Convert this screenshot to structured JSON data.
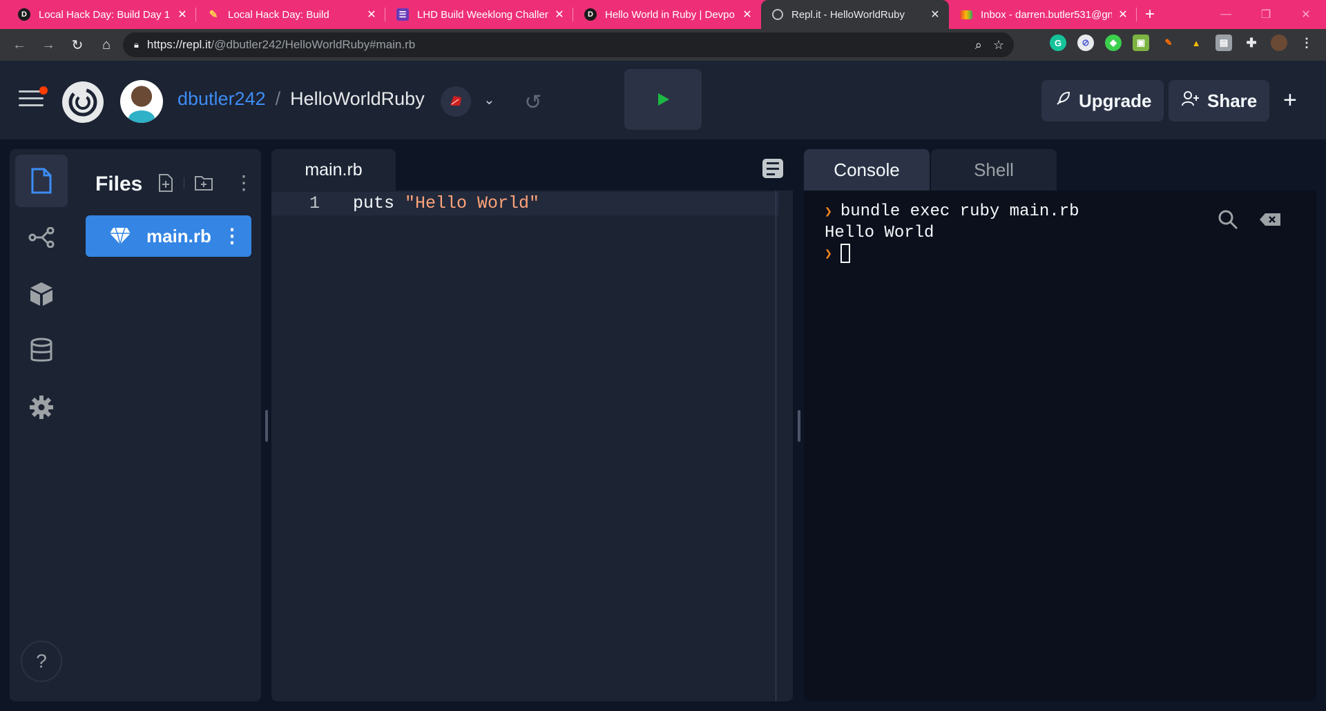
{
  "browser": {
    "tabs": [
      {
        "title": "Local Hack Day: Build Day 1 :",
        "favicon": "devpost-icon",
        "active": false
      },
      {
        "title": "Local Hack Day: Build",
        "favicon": "mlh-icon",
        "active": false
      },
      {
        "title": "LHD Build Weeklong Challen",
        "favicon": "list-icon",
        "active": false
      },
      {
        "title": "Hello World in Ruby | Devpo",
        "favicon": "devpost-icon",
        "active": false
      },
      {
        "title": "Repl.it - HelloWorldRuby",
        "favicon": "replit-icon",
        "active": true
      },
      {
        "title": "Inbox - darren.butler531@gn",
        "favicon": "gmail-icon",
        "active": false
      }
    ],
    "url_host": "https://repl.it",
    "url_path": "/@dbutler242/HelloWorldRuby#main.rb"
  },
  "header": {
    "username": "dbutler242",
    "separator": "/",
    "repl_name": "HelloWorldRuby",
    "upgrade_label": "Upgrade",
    "share_label": "Share"
  },
  "sidebar": {
    "title": "Files",
    "files": [
      {
        "name": "main.rb",
        "selected": true
      }
    ],
    "help_label": "?"
  },
  "editor": {
    "tab_label": "main.rb",
    "lines": [
      {
        "num": "1",
        "code_prefix": "puts ",
        "code_string": "\"Hello World\""
      }
    ]
  },
  "console": {
    "tabs": [
      "Console",
      "Shell"
    ],
    "active_tab": "Console",
    "command": "bundle exec ruby main.rb",
    "output": "Hello World"
  },
  "colors": {
    "tab_strip": "#ee2f78",
    "header_bg": "#1c2333",
    "accent_blue": "#3485e4",
    "run_green": "#1cb843",
    "string_orange": "#ffa37a"
  }
}
